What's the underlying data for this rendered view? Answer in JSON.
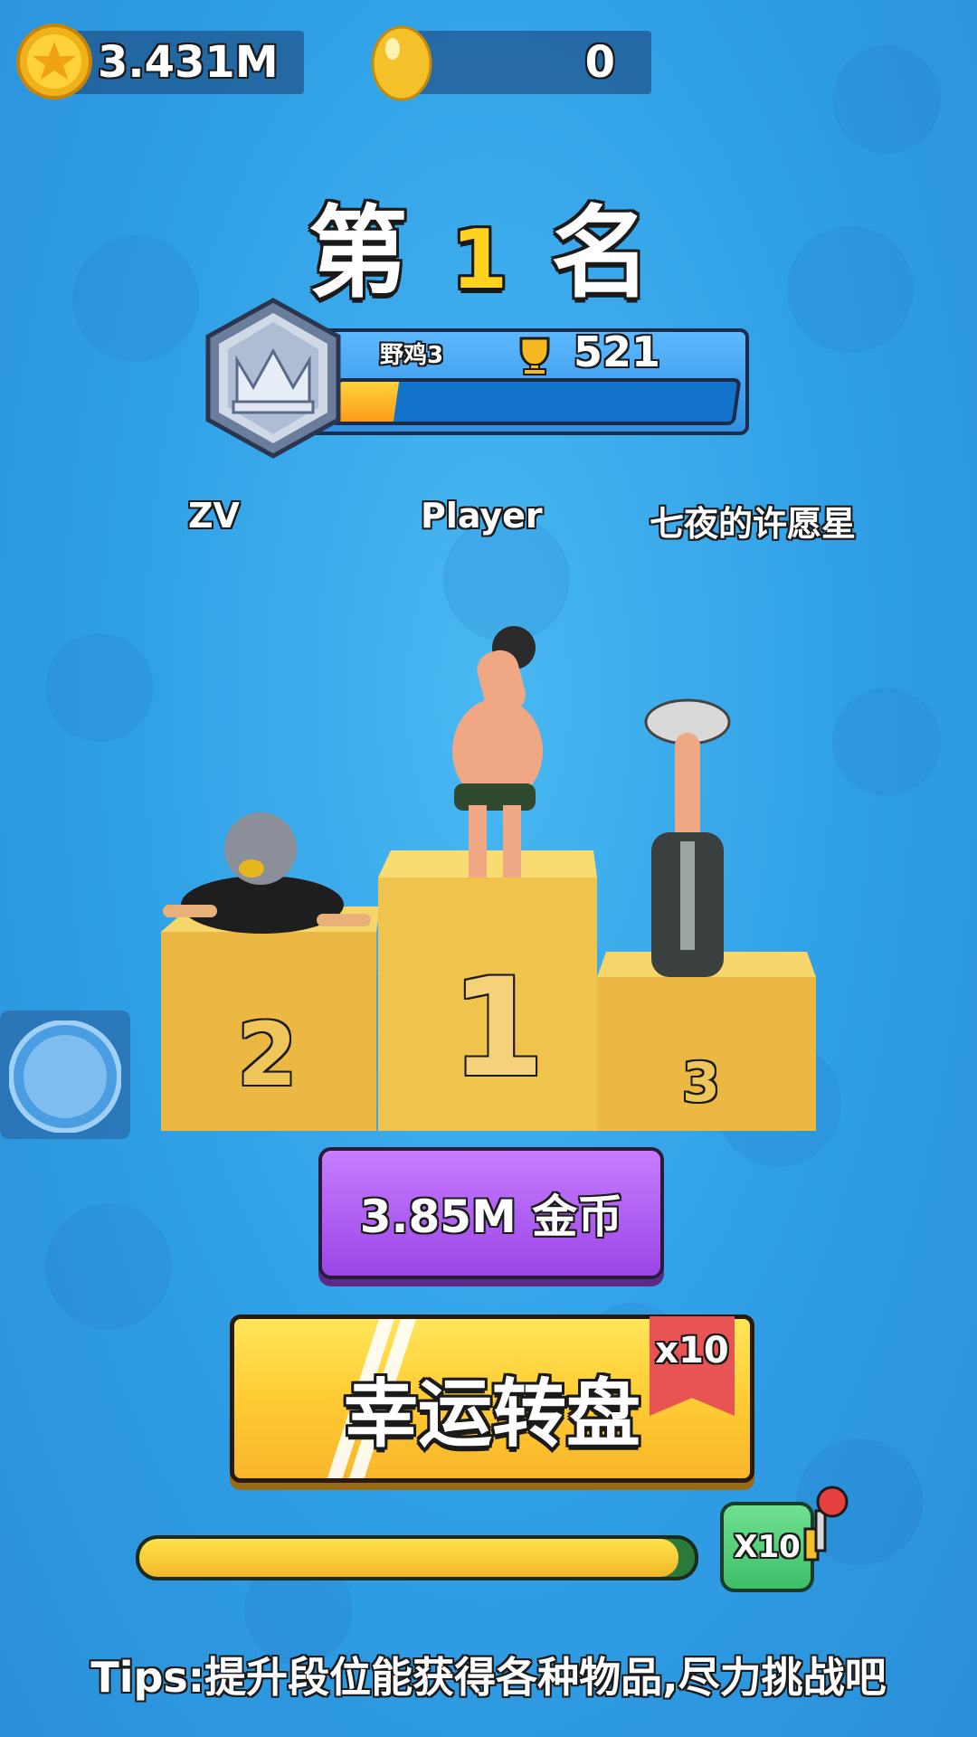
{
  "currency": {
    "coins": "3.431M",
    "gems": "0"
  },
  "title": {
    "prefix": "第",
    "rank": "1",
    "suffix": "名"
  },
  "rank_panel": {
    "tier_name": "野鸡3",
    "trophies": "521",
    "progress": 0.15
  },
  "players": {
    "left": "ZV",
    "center": "Player",
    "right": "七夜的许愿星"
  },
  "podium": {
    "first": "1",
    "second": "2",
    "third": "3"
  },
  "reward_button": {
    "label": "3.85M  金币"
  },
  "spin_button": {
    "label": "幸运转盘",
    "badge": "x10"
  },
  "multiplier": {
    "label": "X10",
    "bar_progress": 0.97
  },
  "tips": "Tips:提升段位能获得各种物品,尽力挑战吧",
  "colors": {
    "background": "#2f9fe6",
    "coin_button": "#9b45e6",
    "spin_button": "#ffcc33",
    "ribbon": "#e85454",
    "podium": "#eab843"
  }
}
